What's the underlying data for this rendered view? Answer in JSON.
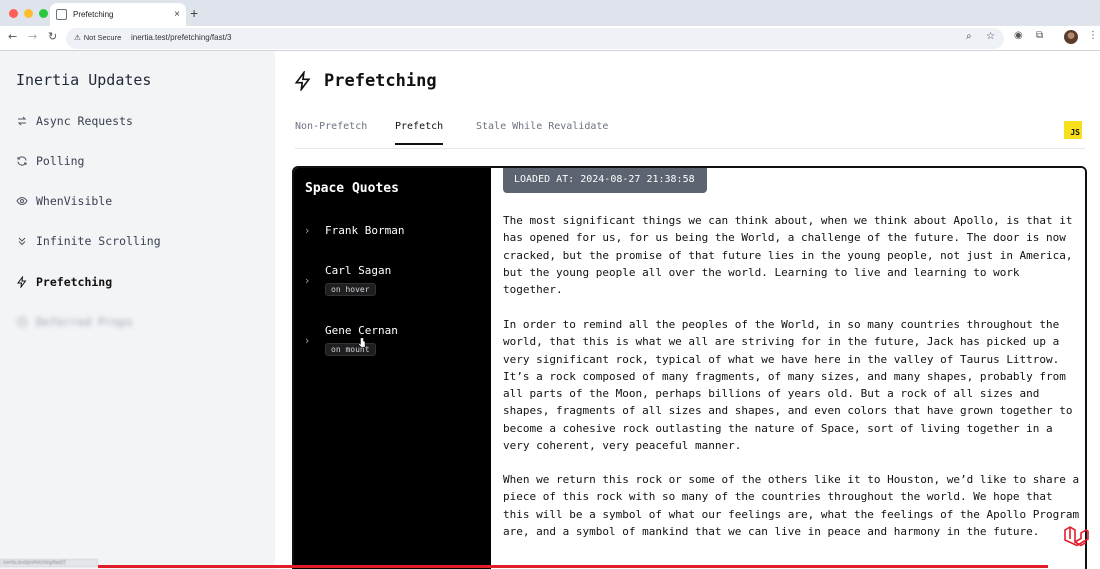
{
  "browser": {
    "tab_title": "Prefetching",
    "tab_close": "×",
    "new_tab": "+",
    "security_label": "Not Secure",
    "url": "inertia.test/prefetching/fast/3",
    "status_url": "inertia.test/prefetching/fast/2"
  },
  "sidebar": {
    "brand": "Inertia Updates",
    "items": [
      {
        "label": "Async Requests",
        "icon": "arrows-exchange-icon"
      },
      {
        "label": "Polling",
        "icon": "refresh-icon"
      },
      {
        "label": "WhenVisible",
        "icon": "eye-icon"
      },
      {
        "label": "Infinite Scrolling",
        "icon": "chevrons-down-icon"
      },
      {
        "label": "Prefetching",
        "icon": "bolt-icon",
        "active": true
      },
      {
        "label": "Deferred Props",
        "icon": "clock-icon"
      }
    ]
  },
  "main": {
    "title": "Prefetching",
    "tabs": [
      "Non-Prefetch",
      "Prefetch",
      "Stale While Revalidate"
    ],
    "active_tab": "Prefetch",
    "js_badge": "JS"
  },
  "card": {
    "title": "Space Quotes",
    "people": [
      {
        "name": "Frank Borman",
        "badge": ""
      },
      {
        "name": "Carl Sagan",
        "badge": "on hover"
      },
      {
        "name": "Gene Cernan",
        "badge": "on mount"
      }
    ],
    "loaded_at": "LOADED AT: 2024-08-27 21:38:58",
    "paragraphs": [
      "The most significant things we can think about, when we think about Apollo, is that it has opened for us, for us being the World, a challenge of the future. The door is now cracked, but the promise of that future lies in the young people, not just in America, but the young people all over the world. Learning to live and learning to work together.",
      "In order to remind all the peoples of the World, in so many countries throughout the world, that this is what we all are striving for in the future, Jack has picked up a very significant rock, typical of what we have here in the valley of Taurus Littrow. It’s a rock composed of many fragments, of many sizes, and many shapes, probably from all parts of the Moon, perhaps billions of years old. But a rock of all sizes and shapes, fragments of all sizes and shapes, and even colors that have grown together to become a cohesive rock outlasting the nature of Space, sort of living together in a very coherent, very peaceful manner.",
      "When we return this rock or some of the others like it to Houston, we’d like to share a piece of this rock with so many of the countries throughout the world. We hope that this will be a symbol of what our feelings are, what the feelings of the Apollo Program are, and a symbol of mankind that we can live in peace and harmony in the future."
    ]
  },
  "colors": {
    "accent_red": "#e11d2a",
    "js_yellow": "#f7df1e",
    "loaded_badge": "#5b6470"
  }
}
